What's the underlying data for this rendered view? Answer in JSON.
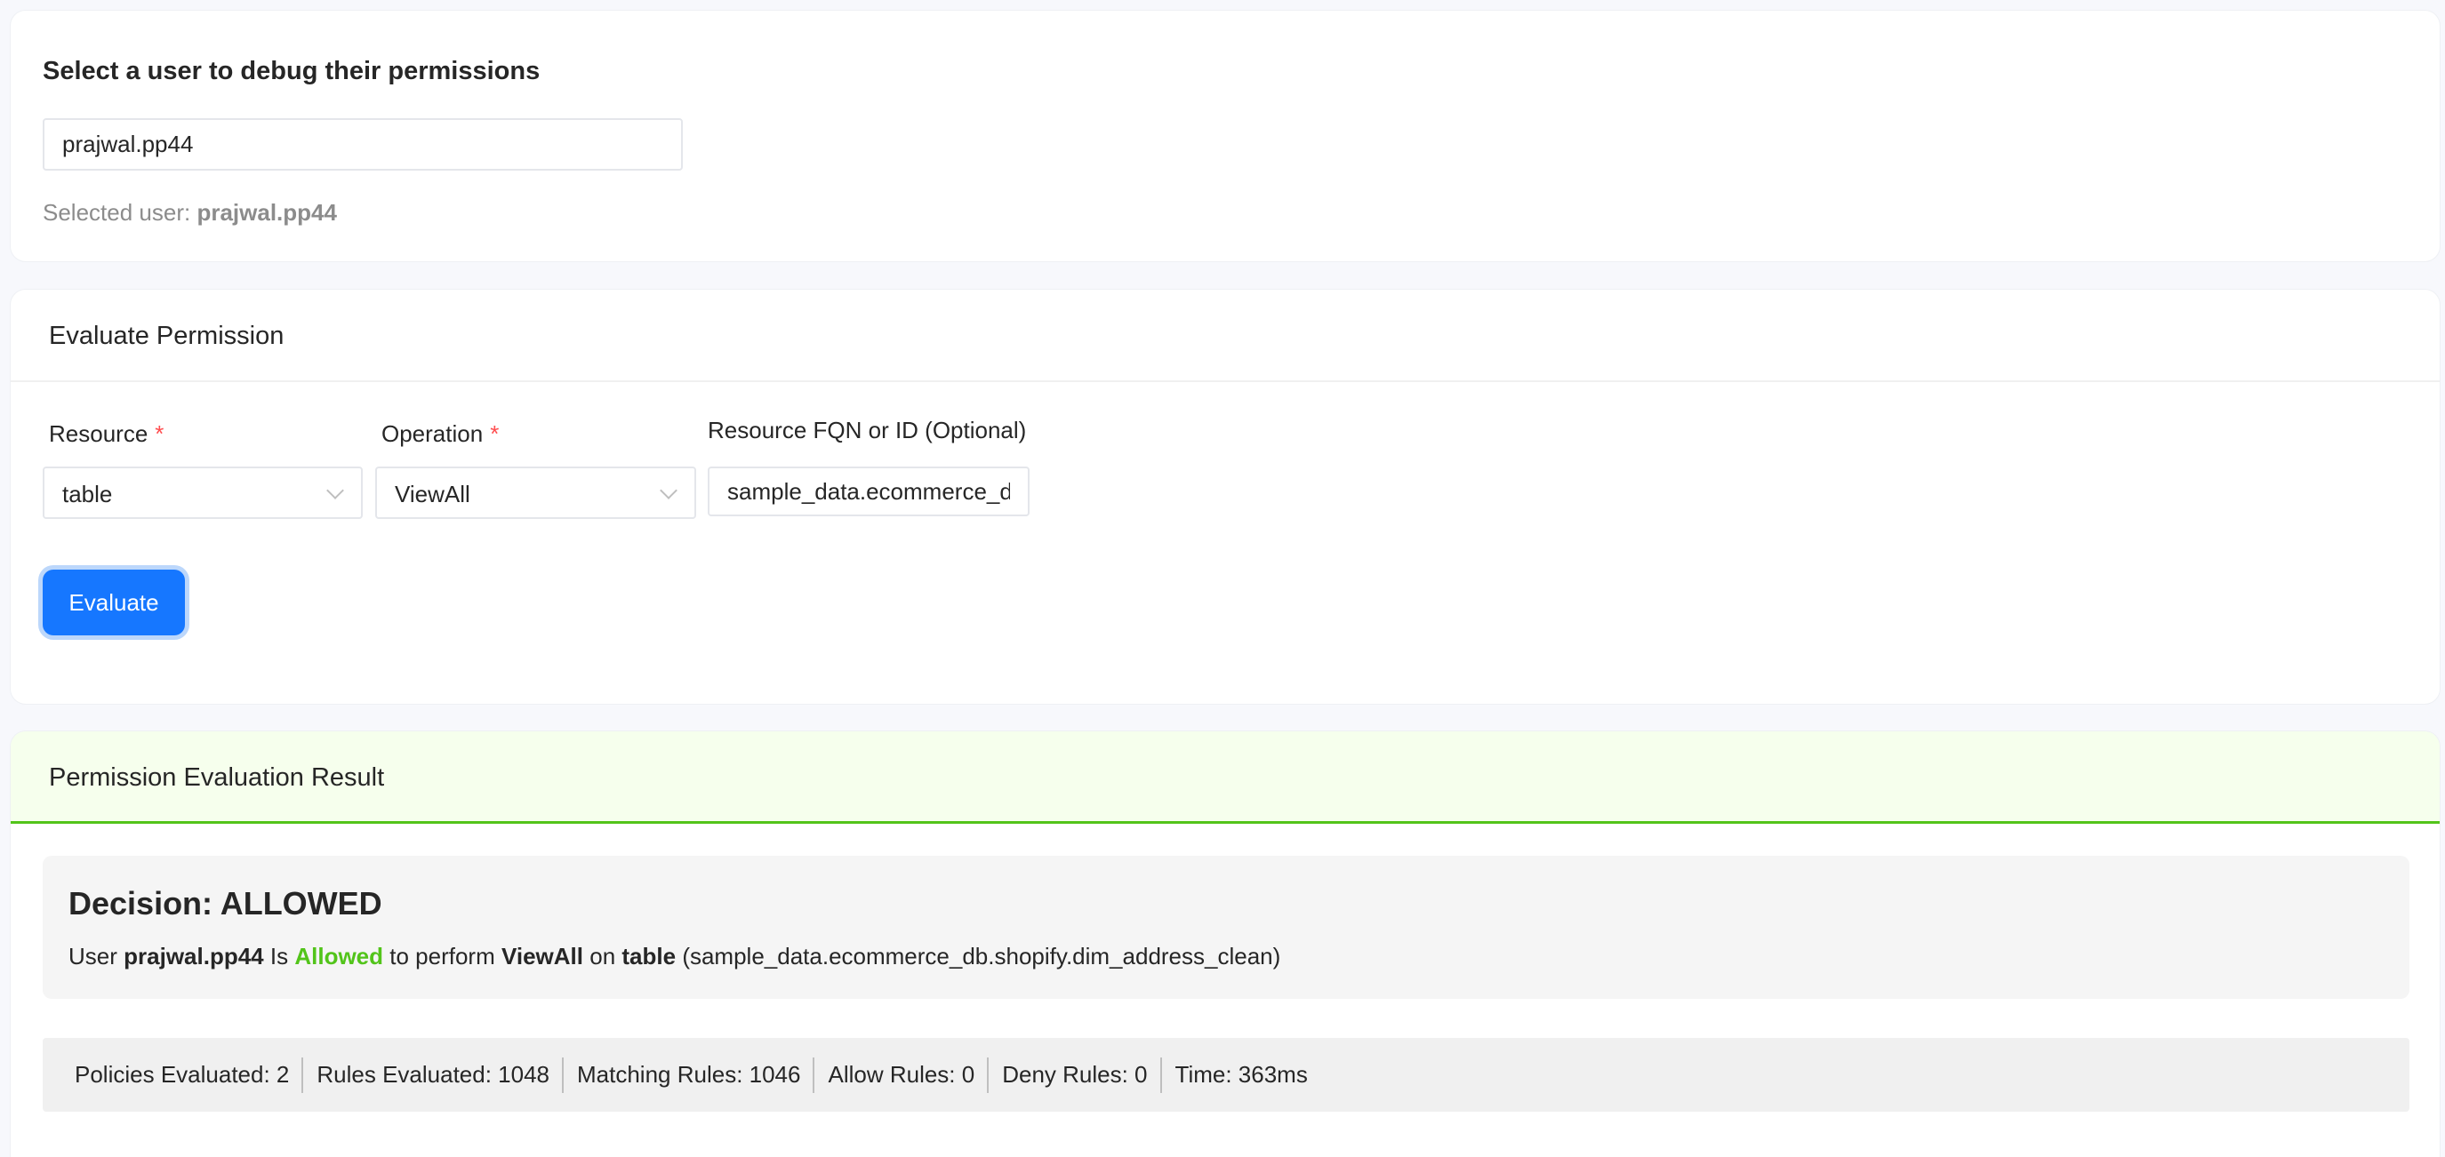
{
  "user_section": {
    "title": "Select a user to debug their permissions",
    "input_value": "prajwal.pp44",
    "selected_label": "Selected user:",
    "selected_value": "prajwal.pp44"
  },
  "evaluate_section": {
    "title": "Evaluate Permission",
    "resource_label": "Resource",
    "resource_value": "table",
    "operation_label": "Operation",
    "operation_value": "ViewAll",
    "required_mark": "*",
    "fqn_label": "Resource FQN or ID (Optional)",
    "fqn_value": "sample_data.ecommerce_db.shopify.dim_address_clean",
    "evaluate_button": "Evaluate"
  },
  "result_section": {
    "title": "Permission Evaluation Result",
    "decision_title": "Decision: ALLOWED",
    "sentence": {
      "p1": "User",
      "user": "prajwal.pp44",
      "p2": "Is",
      "allowed": "Allowed",
      "p3": "to perform",
      "operation": "ViewAll",
      "p4": "on",
      "resource": "table",
      "fqn": "(sample_data.ecommerce_db.shopify.dim_address_clean)"
    },
    "stats": [
      "Policies Evaluated: 2",
      "Rules Evaluated: 1048",
      "Matching Rules: 1046",
      "Allow Rules: 0",
      "Deny Rules: 0",
      "Time: 363ms"
    ],
    "accent_color": "#52c41a"
  },
  "colors": {
    "primary": "#1677ff",
    "required": "#ff4d4f",
    "success_bg": "#f6ffed"
  }
}
